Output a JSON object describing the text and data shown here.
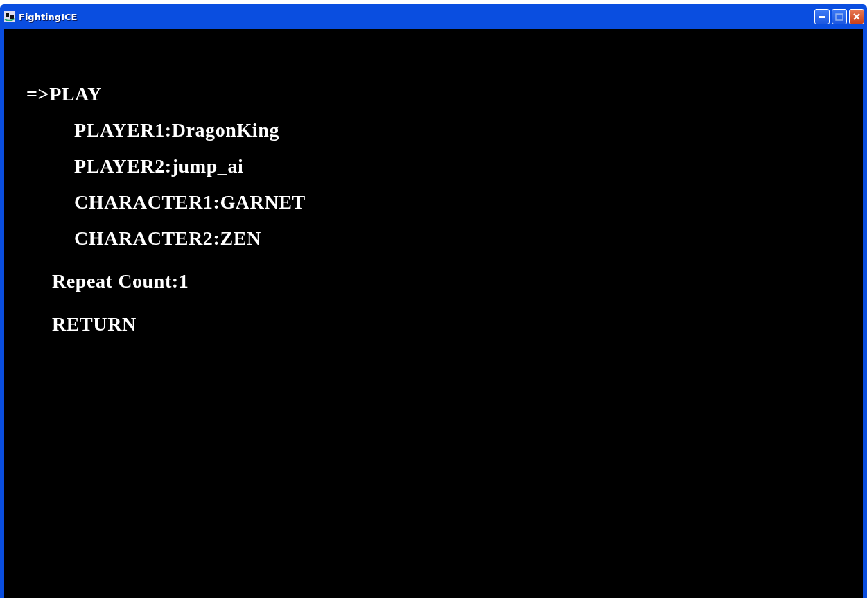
{
  "window": {
    "title": "FightingICE"
  },
  "cursor": "=>",
  "menu": [
    {
      "label": "PLAY",
      "selected": true,
      "children": [
        {
          "label": "PLAYER1:DragonKing",
          "selected": false
        },
        {
          "label": "PLAYER2:jump_ai",
          "selected": false
        },
        {
          "label": "CHARACTER1:GARNET",
          "selected": false
        },
        {
          "label": "CHARACTER2:ZEN",
          "selected": false
        }
      ]
    },
    {
      "label": "Repeat Count:1",
      "selected": false
    },
    {
      "label": "RETURN",
      "selected": false
    }
  ]
}
